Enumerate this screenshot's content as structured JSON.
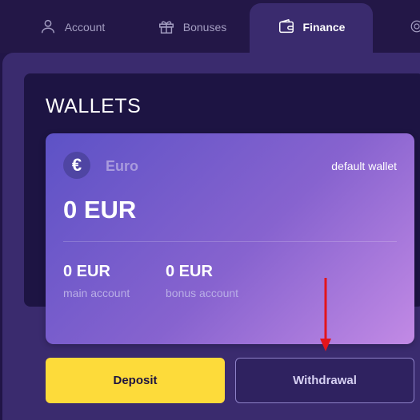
{
  "tabs": [
    {
      "label": "Account",
      "icon": "user-icon"
    },
    {
      "label": "Bonuses",
      "icon": "gift-icon"
    },
    {
      "label": "Finance",
      "icon": "wallet-icon",
      "active": true
    },
    {
      "label": "",
      "icon": "settings-icon"
    }
  ],
  "wallets": {
    "title": "WALLETS",
    "card": {
      "currency_symbol": "€",
      "currency_name": "Euro",
      "default_label": "default wallet",
      "balance": "0 EUR",
      "main_amount": "0 EUR",
      "main_label": "main account",
      "bonus_amount": "0 EUR",
      "bonus_label": "bonus account"
    }
  },
  "actions": {
    "deposit_label": "Deposit",
    "withdraw_label": "Withdrawal"
  },
  "colors": {
    "accent_yellow": "#fddb3a",
    "arrow_red": "#e3151b"
  }
}
